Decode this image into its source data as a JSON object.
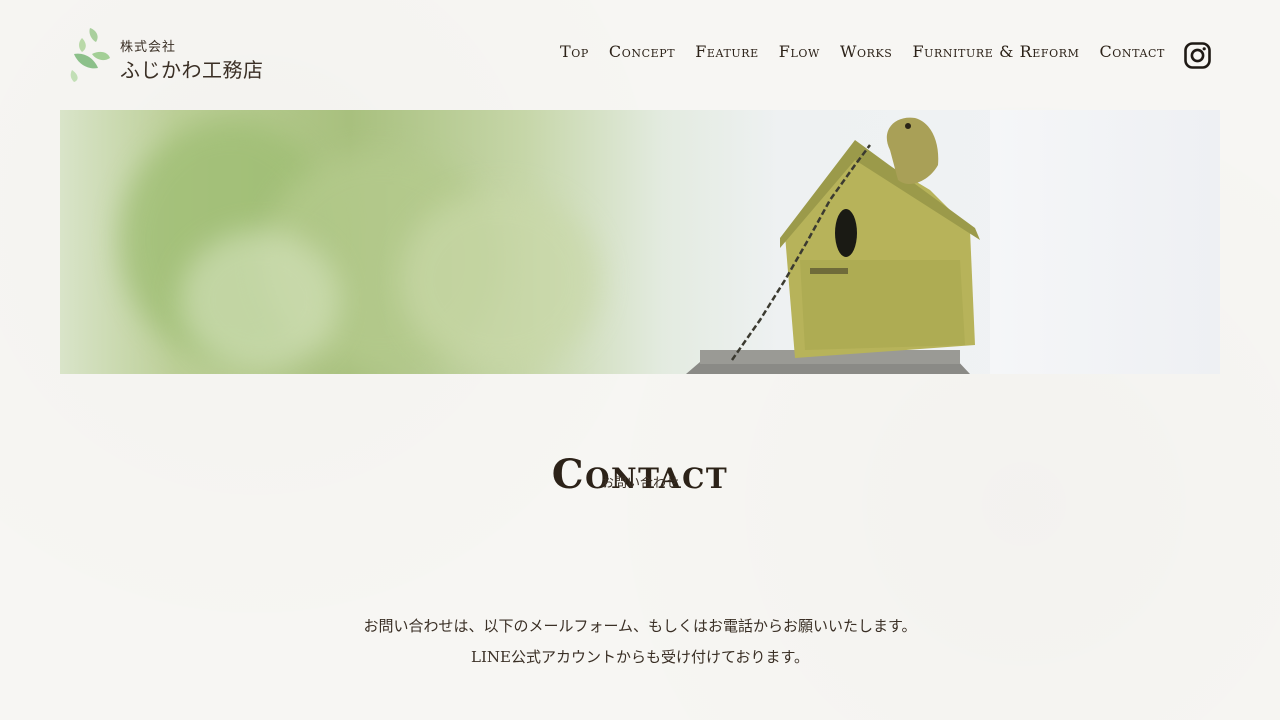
{
  "header": {
    "logo_small": "株式会社",
    "logo_main": "ふじかわ工務店",
    "nav": [
      {
        "label": "Top"
      },
      {
        "label": "Concept"
      },
      {
        "label": "Feature"
      },
      {
        "label": "Flow"
      },
      {
        "label": "Works"
      },
      {
        "label": "Furniture & Reform"
      },
      {
        "label": "Contact"
      }
    ],
    "instagram_icon": "instagram-icon"
  },
  "hero": {
    "image": "birdhouse-photo"
  },
  "section": {
    "title": "Contact",
    "subtitle": "お問い合わせ"
  },
  "intro": {
    "line1": "お問い合わせは、以下のメールフォーム、もしくはお電話からお願いいたします。",
    "line2": "LINE公式アカウントからも受け付けております。"
  },
  "colors": {
    "background": "#f7f6f3",
    "text": "#3a2f25",
    "logo_leaf": "#8cc08a"
  }
}
